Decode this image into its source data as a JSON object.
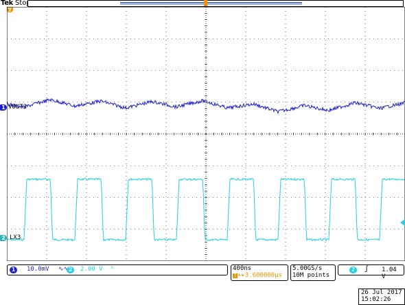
{
  "header": {
    "brand": "Tek",
    "run_state": "Stop"
  },
  "channels": [
    {
      "id": "1",
      "label": "VOUT3",
      "color": "#1a1fc8",
      "scale": "10.0mV",
      "coupling_icon": "∿∿"
    },
    {
      "id": "2",
      "label": "LX3",
      "color": "#22d0e0",
      "scale": "2.00 V",
      "coupling_icon": "ʰ"
    }
  ],
  "trigger_marker": {
    "label": "T"
  },
  "acquisition": {
    "timebase": "400ns",
    "trigger_delay": "+▸3.600000μs",
    "sample_rate": "5.00GS/s",
    "record_length": "10M points"
  },
  "trigger": {
    "source": "2",
    "slope_icon": "rising-edge-icon",
    "level": "1.04 V"
  },
  "datetime": {
    "date": "26 Jul  2017",
    "time": "15:02:26"
  },
  "colors": {
    "ch1": "#1a1fc8",
    "ch2": "#22d0e0",
    "trigger": "#f29000",
    "grid": "#000000"
  }
}
